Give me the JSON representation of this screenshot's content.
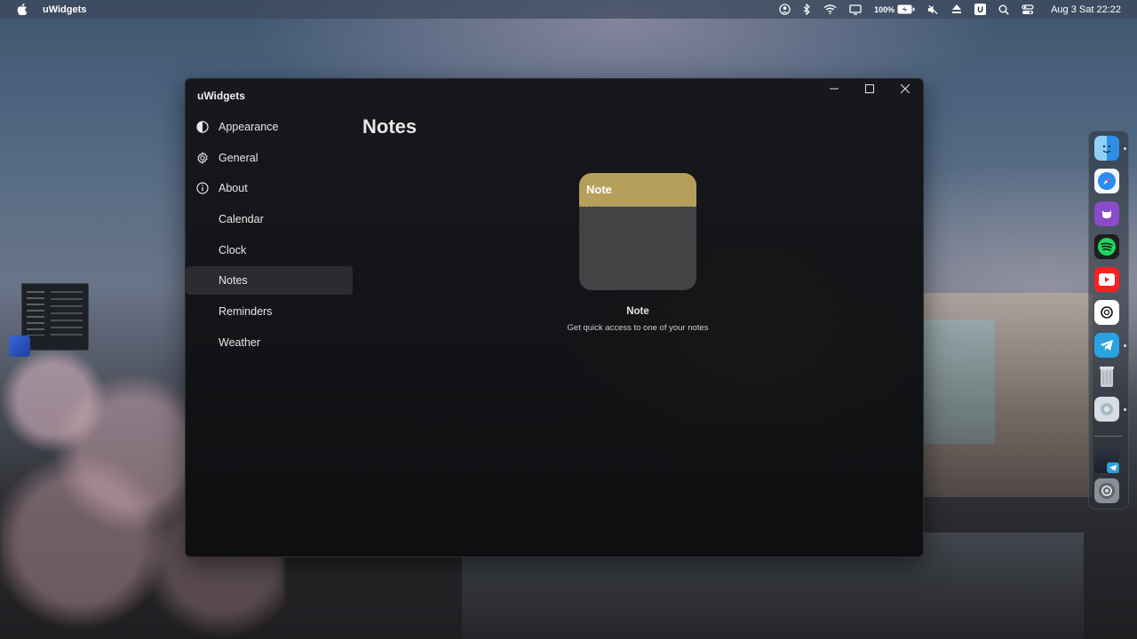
{
  "menubar": {
    "app_name": "uWidgets",
    "battery_percent": "100%",
    "keyboard_indicator": "U",
    "datetime": "Aug 3 Sat 22:22",
    "icons": [
      "apple-icon",
      "user-icon",
      "bluetooth-icon",
      "wifi-icon",
      "display-icon",
      "battery-icon",
      "mute-icon",
      "eject-icon",
      "search-icon",
      "control-center-icon"
    ]
  },
  "window": {
    "title": "uWidgets",
    "controls": [
      "minimize-icon",
      "maximize-icon",
      "close-icon"
    ]
  },
  "sidebar": {
    "items": [
      {
        "label": "Appearance",
        "icon": "contrast-icon"
      },
      {
        "label": "General",
        "icon": "gear-icon"
      },
      {
        "label": "About",
        "icon": "info-icon"
      },
      {
        "label": "Calendar",
        "icon": ""
      },
      {
        "label": "Clock",
        "icon": ""
      },
      {
        "label": "Notes",
        "icon": "",
        "active": true
      },
      {
        "label": "Reminders",
        "icon": ""
      },
      {
        "label": "Weather",
        "icon": ""
      }
    ]
  },
  "main": {
    "page_title": "Notes",
    "widget": {
      "header_label": "Note",
      "name": "Note",
      "description": "Get quick access to one of your notes",
      "header_color": "#b59f5a",
      "body_color": "#434345"
    }
  },
  "dock": {
    "apps": [
      "finder-icon",
      "safari-icon",
      "github-icon",
      "spotify-icon",
      "youtube-icon",
      "chatgpt-icon",
      "telegram-icon",
      "trash-icon",
      "app-icon",
      "window-preview-icon",
      "system-settings-icon"
    ]
  }
}
